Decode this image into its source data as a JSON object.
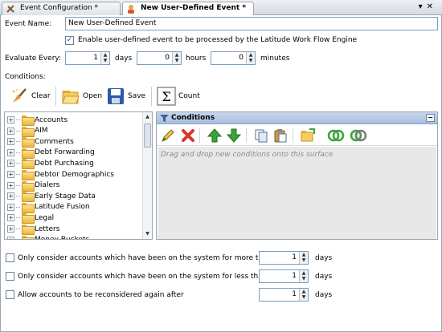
{
  "tabs": [
    {
      "label": "Event Configuration *",
      "active": false
    },
    {
      "label": "New User-Defined Event *",
      "active": true
    }
  ],
  "tab_controls": {
    "dropdown": "▾",
    "close": "✕"
  },
  "event_name": {
    "label": "Event Name:",
    "value": "New User-Defined Event"
  },
  "enable": {
    "checked": true,
    "label": "Enable user-defined event to be processed by the Latitude Work Flow Engine"
  },
  "evaluate": {
    "label": "Evaluate Every:",
    "days": {
      "value": "1",
      "unit": "days"
    },
    "hours": {
      "value": "0",
      "unit": "hours"
    },
    "minutes": {
      "value": "0",
      "unit": "minutes"
    }
  },
  "conditions_label": "Conditions:",
  "toolbar": {
    "clear": "Clear",
    "open": "Open",
    "save": "Save",
    "count": "Count"
  },
  "tree_items": [
    "Accounts",
    "AIM",
    "Comments",
    "Debt Forwarding",
    "Debt Purchasing",
    "Debtor Demographics",
    "Dialers",
    "Early Stage Data",
    "Latitude Fusion",
    "Legal",
    "Letters",
    "Money Buckets"
  ],
  "conditions_panel": {
    "title": "Conditions",
    "hint": "Drag and drop new conditions onto this surface"
  },
  "options": [
    {
      "label": "Only consider accounts which have been on the system for more than",
      "value": "1",
      "unit": "days",
      "checked": false
    },
    {
      "label": "Only consider accounts which have been on the system for less than",
      "value": "1",
      "unit": "days",
      "checked": false
    },
    {
      "label": "Allow accounts to be reconsidered again after",
      "value": "1",
      "unit": "days",
      "checked": false
    }
  ],
  "colors": {
    "accent": "#a9bedd",
    "delete_red": "#d9342b",
    "arrow_green": "#3aa33a"
  }
}
